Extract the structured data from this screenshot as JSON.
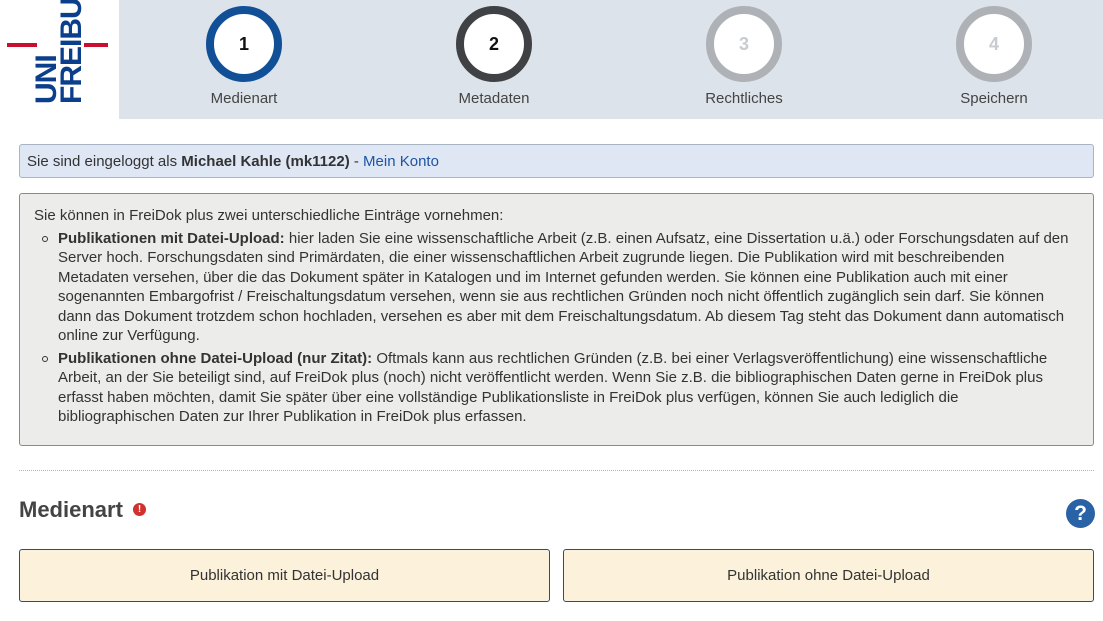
{
  "logo": {
    "line1": "UNI",
    "line2": "FREIBU"
  },
  "steps": [
    {
      "number": "1",
      "label": "Medienart",
      "state": "active"
    },
    {
      "number": "2",
      "label": "Metadaten",
      "state": "visited"
    },
    {
      "number": "3",
      "label": "Rechtliches",
      "state": "disabled"
    },
    {
      "number": "4",
      "label": "Speichern",
      "state": "disabled"
    }
  ],
  "login": {
    "prefix": "Sie sind eingeloggt als",
    "user": "Michael Kahle (mk1122)",
    "separator": "-",
    "account_link": "Mein Konto"
  },
  "info": {
    "intro": "Sie können in FreiDok plus zwei unterschiedliche Einträge vornehmen:",
    "items": [
      {
        "title": "Publikationen mit Datei-Upload:",
        "text": "hier laden Sie eine wissenschaftliche Arbeit (z.B. einen Aufsatz, eine Dissertation u.ä.) oder Forschungsdaten auf den Server hoch. Forschungsdaten sind Primärdaten, die einer wissenschaftlichen Arbeit zugrunde liegen. Die Publikation wird mit beschreibenden Metadaten versehen, über die das Dokument später in Katalogen und im Internet gefunden werden. Sie können eine Publikation auch mit einer sogenannten Embargofrist / Freischaltungsdatum versehen, wenn sie aus rechtlichen Gründen noch nicht öffentlich zugänglich sein darf. Sie können dann das Dokument trotzdem schon hochladen, versehen es aber mit dem Freischaltungsdatum. Ab diesem Tag steht das Dokument dann automatisch online zur Verfügung."
      },
      {
        "title": "Publikationen ohne Datei-Upload (nur Zitat):",
        "text": "Oftmals kann aus rechtlichen Gründen (z.B. bei einer Verlagsveröffentlichung) eine wissenschaftliche Arbeit, an der Sie beteiligt sind, auf FreiDok plus (noch) nicht veröffentlicht werden. Wenn Sie z.B. die bibliographischen Daten gerne in FreiDok plus erfasst haben möchten, damit Sie später über eine vollständige Publikationsliste in FreiDok plus verfügen, können Sie auch lediglich die bibliographischen Daten zur Ihrer Publikation in FreiDok plus erfassen."
      }
    ]
  },
  "section": {
    "title": "Medienart",
    "required_icon": "!",
    "help_icon": "?"
  },
  "choices": {
    "with_upload": "Publikation mit Datei-Upload",
    "without_upload": "Publikation ohne Datei-Upload"
  }
}
